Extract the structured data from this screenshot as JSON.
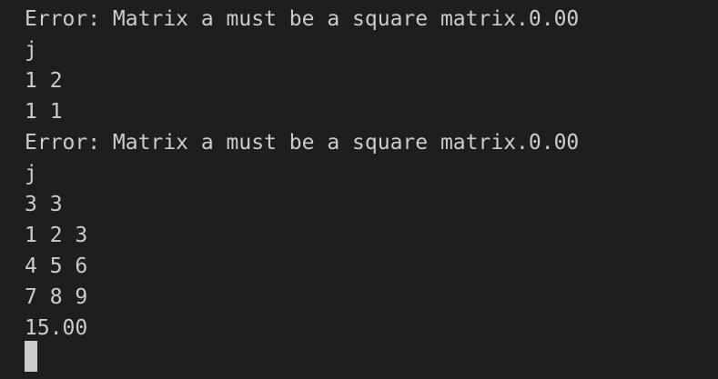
{
  "terminal": {
    "lines": [
      "Error: Matrix a must be a square matrix.0.00",
      "j",
      "1 2",
      "1 1",
      "Error: Matrix a must be a square matrix.0.00",
      "j",
      "3 3",
      "1 2 3",
      "4 5 6",
      "7 8 9",
      "15.00"
    ],
    "colors": {
      "background": "#1e1e1e",
      "text": "#cccccc",
      "cursor": "#cccccc"
    }
  }
}
